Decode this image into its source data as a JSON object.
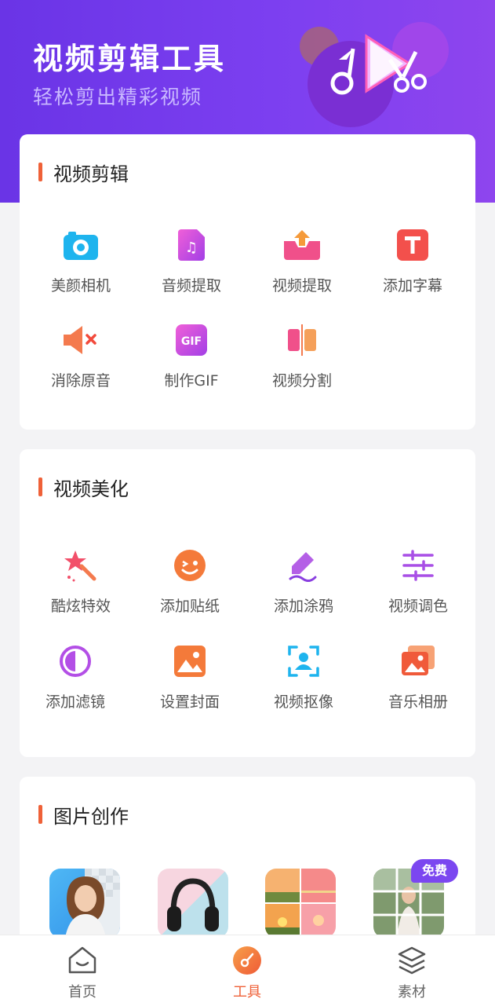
{
  "banner": {
    "title": "视频剪辑工具",
    "subtitle": "轻松剪出精彩视频"
  },
  "sections": [
    {
      "title": "视频剪辑",
      "tools": [
        {
          "label": "美颜相机",
          "icon": "camera-icon"
        },
        {
          "label": "音频提取",
          "icon": "music-file-icon"
        },
        {
          "label": "视频提取",
          "icon": "upload-tray-icon"
        },
        {
          "label": "添加字幕",
          "icon": "text-t-icon"
        },
        {
          "label": "消除原音",
          "icon": "mute-speaker-icon"
        },
        {
          "label": "制作GIF",
          "icon": "gif-icon"
        },
        {
          "label": "视频分割",
          "icon": "split-icon"
        }
      ]
    },
    {
      "title": "视频美化",
      "tools": [
        {
          "label": "酷炫特效",
          "icon": "magic-wand-icon"
        },
        {
          "label": "添加贴纸",
          "icon": "smiley-sticker-icon"
        },
        {
          "label": "添加涂鸦",
          "icon": "pen-scribble-icon"
        },
        {
          "label": "视频调色",
          "icon": "sliders-icon"
        },
        {
          "label": "添加滤镜",
          "icon": "filter-circle-icon"
        },
        {
          "label": "设置封面",
          "icon": "image-cover-icon"
        },
        {
          "label": "视频抠像",
          "icon": "portrait-scan-icon"
        },
        {
          "label": "音乐相册",
          "icon": "photo-album-icon"
        }
      ]
    },
    {
      "title": "图片创作",
      "badge": "免费"
    }
  ],
  "tabbar": [
    {
      "label": "首页",
      "icon": "home-icon",
      "active": false
    },
    {
      "label": "工具",
      "icon": "tools-icon",
      "active": true
    },
    {
      "label": "素材",
      "icon": "layers-icon",
      "active": false
    }
  ],
  "colors": {
    "accent": "#ef6138",
    "banner": "#6a34e6",
    "badge": "#7b47f0"
  }
}
